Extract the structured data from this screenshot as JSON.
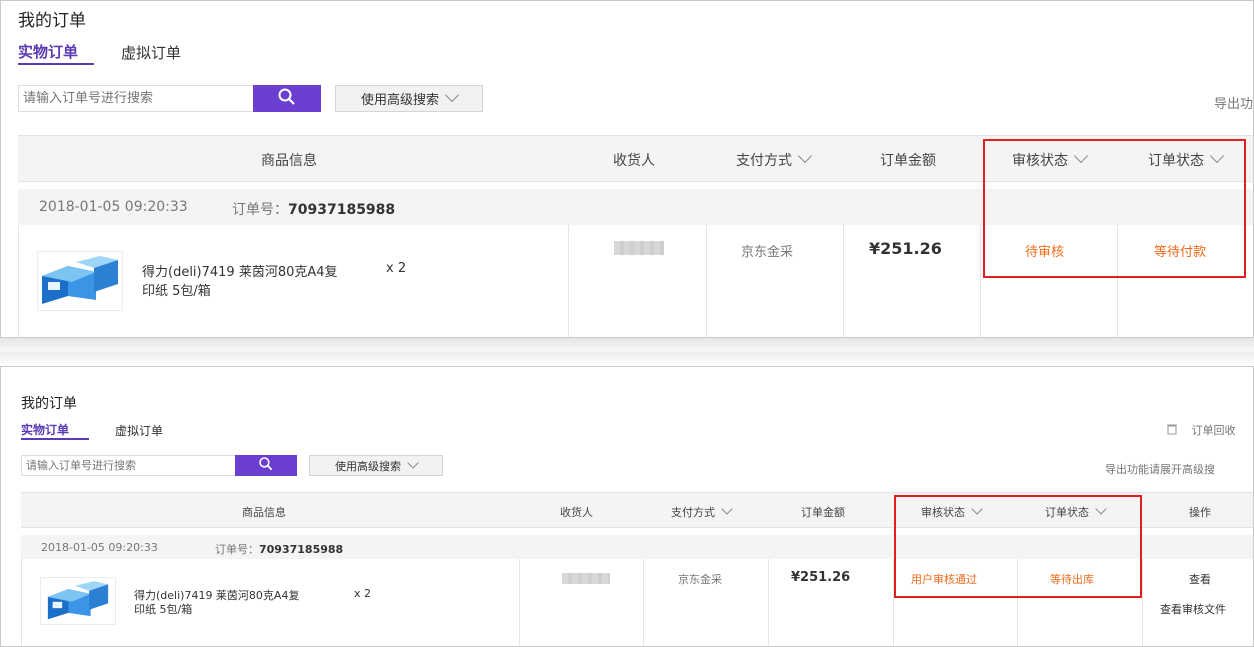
{
  "panel1": {
    "title": "我的订单",
    "tabs": [
      "实物订单",
      "虚拟订单"
    ],
    "search_placeholder": "请输入订单号进行搜索",
    "advanced_search": "使用高级搜索",
    "export_text": "导出功",
    "columns": [
      "商品信息",
      "收货人",
      "支付方式",
      "订单金额",
      "审核状态",
      "订单状态"
    ],
    "order": {
      "date": "2018-01-05 09:20:33",
      "order_no_label": "订单号：",
      "order_no": "70937185988",
      "product_name": "得力(deli)7419 莱茵河80克A4复",
      "product_name_2": "印纸 5包/箱",
      "quantity": "x 2",
      "payment": "京东金采",
      "amount": "¥251.26",
      "audit_status": "待审核",
      "order_status": "等待付款"
    }
  },
  "panel2": {
    "title": "我的订单",
    "tabs": [
      "实物订单",
      "虚拟订单"
    ],
    "search_placeholder": "请输入订单号进行搜索",
    "advanced_search": "使用高级搜索",
    "recycle_text": "订单回收",
    "export_text": "导出功能请展开高级搜",
    "columns": [
      "商品信息",
      "收货人",
      "支付方式",
      "订单金额",
      "审核状态",
      "订单状态",
      "操作"
    ],
    "order": {
      "date": "2018-01-05 09:20:33",
      "order_no_label": "订单号：",
      "order_no": "70937185988",
      "product_name": "得力(deli)7419 莱茵河80克A4复",
      "product_name_2": "印纸 5包/箱",
      "quantity": "x 2",
      "payment": "京东金采",
      "amount": "¥251.26",
      "audit_status": "用户审核通过",
      "order_status": "等待出库",
      "actions": [
        "查看",
        "查看审核文件"
      ]
    }
  },
  "colors": {
    "accent": "#6a3fd0",
    "status": "#f06a1b",
    "highlight": "#e02020"
  }
}
